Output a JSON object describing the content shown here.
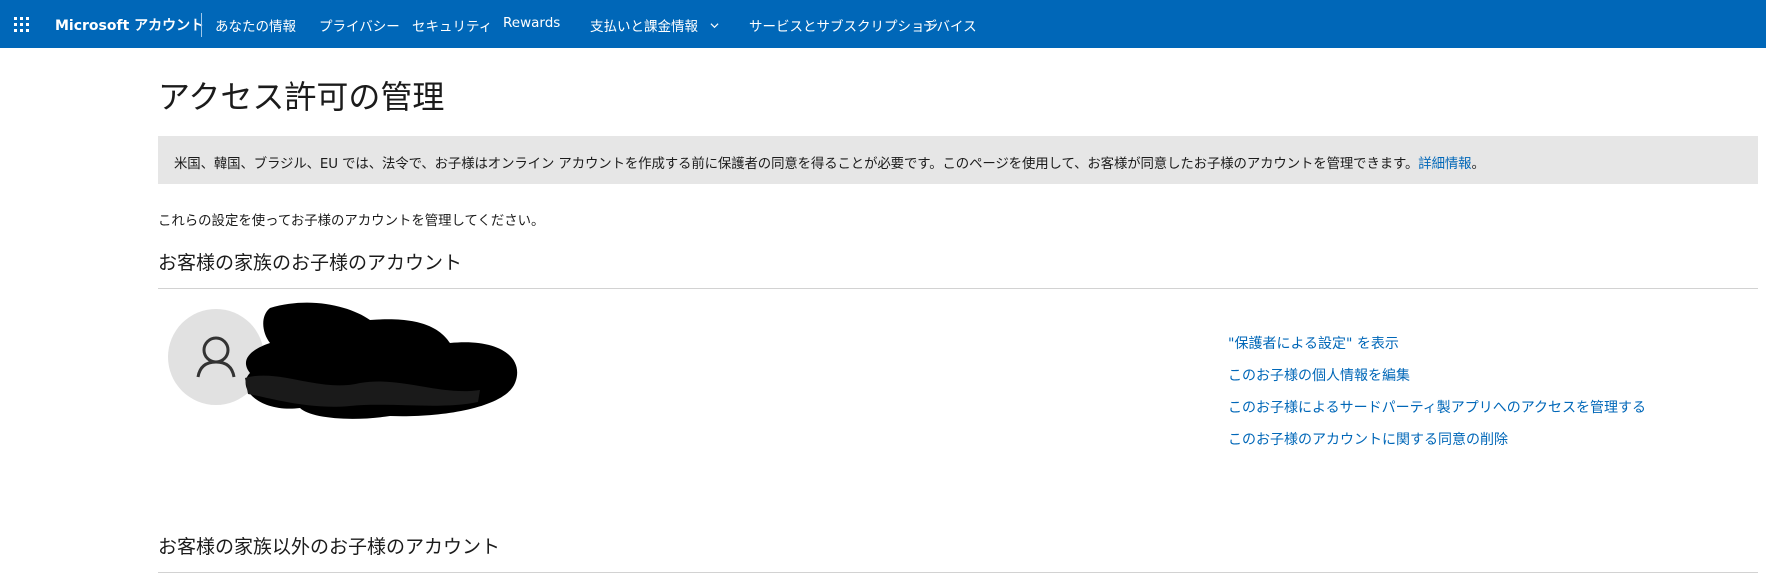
{
  "header": {
    "brand": "Microsoft アカウント",
    "nav": [
      {
        "label": "あなたの情報"
      },
      {
        "label": "プライバシー"
      },
      {
        "label": "セキュリティ"
      },
      {
        "label": "Rewards"
      },
      {
        "label": "支払いと課金情報",
        "has_dropdown": true
      },
      {
        "label": "サービスとサブスクリプション"
      },
      {
        "label": "デバイス"
      }
    ]
  },
  "page": {
    "title": "アクセス許可の管理",
    "notice": {
      "text": "米国、韓国、ブラジル、EU では、法令で、お子様はオンライン アカウントを作成する前に保護者の同意を得ることが必要です。このページを使用して、お客様が同意したお子様のアカウントを管理できます。",
      "link": "詳細情報",
      "suffix": "。"
    },
    "intro": "これらの設定を使ってお子様のアカウントを管理してください。",
    "family_section": {
      "heading": "お客様の家族のお子様のアカウント",
      "actions": [
        "\"保護者による設定\" を表示",
        "このお子様の個人情報を編集",
        "このお子様によるサードパーティ製アプリへのアクセスを管理する",
        "このお子様のアカウントに関する同意の削除"
      ]
    },
    "non_family_section": {
      "heading": "お客様の家族以外のお子様のアカウント"
    }
  },
  "colors": {
    "accent": "#0067b8",
    "notice_bg": "#e6e6e6",
    "avatar_bg": "#e1e1e1",
    "redaction": "#000000"
  }
}
